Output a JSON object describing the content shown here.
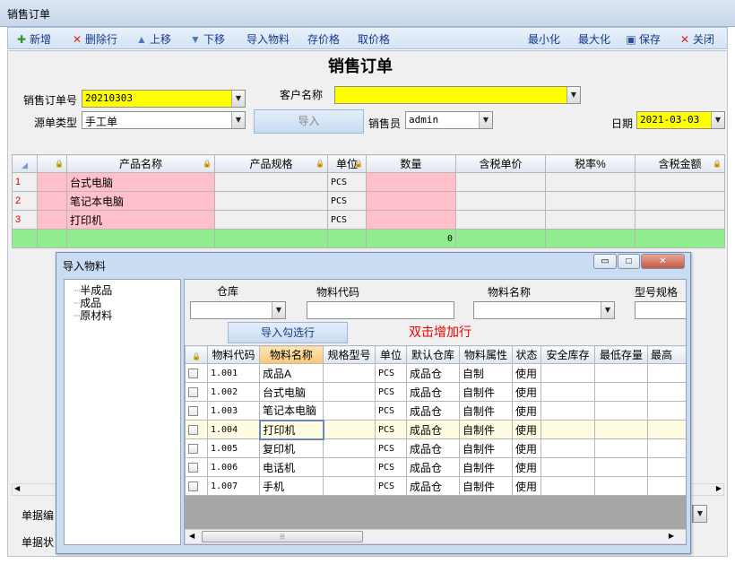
{
  "window": {
    "title": "销售订单"
  },
  "toolbar": {
    "new": "新增",
    "delete_row": "删除行",
    "up": "上移",
    "down": "下移",
    "import_material": "导入物料",
    "save_price": "存价格",
    "load_price": "取价格",
    "minimize": "最小化",
    "maximize": "最大化",
    "save": "保存",
    "close": "关闭"
  },
  "form": {
    "title": "销售订单",
    "order_no_label": "销售订单号",
    "order_no": "20210303",
    "customer_label": "客户名称",
    "customer": "",
    "source_type_label": "源单类型",
    "source_type": "手工单",
    "import_button": "导入",
    "salesperson_label": "销售员",
    "salesperson": "admin",
    "date_label": "日期",
    "date": "2021-03-03"
  },
  "order_grid": {
    "columns": [
      "产品名称",
      "产品规格",
      "单位",
      "数量",
      "含税单价",
      "税率%",
      "含税金额"
    ],
    "rows": [
      {
        "no": "1",
        "name": "台式电脑",
        "spec": "",
        "unit": "PCS"
      },
      {
        "no": "2",
        "name": "笔记本电脑",
        "spec": "",
        "unit": "PCS"
      },
      {
        "no": "3",
        "name": "打印机",
        "spec": "",
        "unit": "PCS"
      }
    ],
    "total_qty": "0"
  },
  "bottom_labels": {
    "doc_no": "单据编",
    "doc_status": "单据状"
  },
  "dialog": {
    "title": "导入物料",
    "tree": [
      "半成品",
      "成品",
      "原材料"
    ],
    "filter_labels": {
      "warehouse": "仓库",
      "code": "物料代码",
      "name": "物料名称",
      "spec": "型号规格"
    },
    "import_selected": "导入勾选行",
    "hint": "双击增加行",
    "columns": [
      "物料代码",
      "物料名称",
      "规格型号",
      "单位",
      "默认仓库",
      "物料属性",
      "状态",
      "安全库存",
      "最低存量",
      "最高"
    ],
    "rows": [
      {
        "code": "1.001",
        "name": "成品A",
        "spec": "",
        "unit": "PCS",
        "wh": "成品仓",
        "attr": "自制",
        "status": "使用"
      },
      {
        "code": "1.002",
        "name": "台式电脑",
        "spec": "",
        "unit": "PCS",
        "wh": "成品仓",
        "attr": "自制件",
        "status": "使用"
      },
      {
        "code": "1.003",
        "name": "笔记本电脑",
        "spec": "",
        "unit": "PCS",
        "wh": "成品仓",
        "attr": "自制件",
        "status": "使用"
      },
      {
        "code": "1.004",
        "name": "打印机",
        "spec": "",
        "unit": "PCS",
        "wh": "成品仓",
        "attr": "自制件",
        "status": "使用"
      },
      {
        "code": "1.005",
        "name": "复印机",
        "spec": "",
        "unit": "PCS",
        "wh": "成品仓",
        "attr": "自制件",
        "status": "使用"
      },
      {
        "code": "1.006",
        "name": "电话机",
        "spec": "",
        "unit": "PCS",
        "wh": "成品仓",
        "attr": "自制件",
        "status": "使用"
      },
      {
        "code": "1.007",
        "name": "手机",
        "spec": "",
        "unit": "PCS",
        "wh": "成品仓",
        "attr": "自制件",
        "status": "使用"
      }
    ]
  }
}
